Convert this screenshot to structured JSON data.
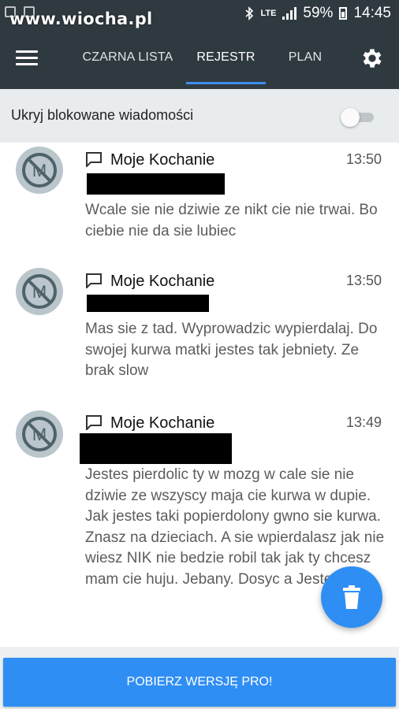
{
  "status_bar": {
    "watermark": "www.wiocha.pl",
    "network": "LTE",
    "battery": "59%",
    "time": "14:45",
    "icons": [
      "bluetooth-icon",
      "signal-icon",
      "battery-icon"
    ]
  },
  "app_bar": {
    "tabs": [
      {
        "label": "CZARNA LISTA",
        "active": false
      },
      {
        "label": "REJESTR",
        "active": true
      },
      {
        "label": "PLAN",
        "active": false
      }
    ],
    "menu_icon": "hamburger-icon",
    "settings_icon": "gear-icon"
  },
  "filter": {
    "label": "Ukryj blokowane wiadomości",
    "toggle_on": false
  },
  "messages": [
    {
      "sender": "Moje Kochanie",
      "time": "13:50",
      "text": "Wcale sie nie dziwie ze nikt cie nie trwai. Bo ciebie nie da sie lubiec"
    },
    {
      "sender": "Moje Kochanie",
      "time": "13:50",
      "text": "Mas sie z tad. Wyprowadzic wypierdalaj. Do swojej kurwa matki jestes tak jebniety. Ze brak slow"
    },
    {
      "sender": "Moje Kochanie",
      "time": "13:49",
      "text": "Jestes pierdolic ty w mozg w cale sie nie dziwie ze wszyscy maja cie kurwa w dupie. Jak jestes taki popierdolony gwno sie kurwa. Znasz na dzieciach. A sie wpierdalasz jak nie wiesz NIK nie bedzie robil tak jak ty chcesz mam cie huju. Jebany. Dosyc a Jestes ty."
    }
  ],
  "fab": {
    "icon": "trash-icon"
  },
  "bottom": {
    "pro_button": "POBIERZ WERSJĘ PRO!"
  },
  "colors": {
    "app_bar": "#2f3a40",
    "accent": "#2f8ef4",
    "tab_indicator": "#3d8ef0"
  }
}
